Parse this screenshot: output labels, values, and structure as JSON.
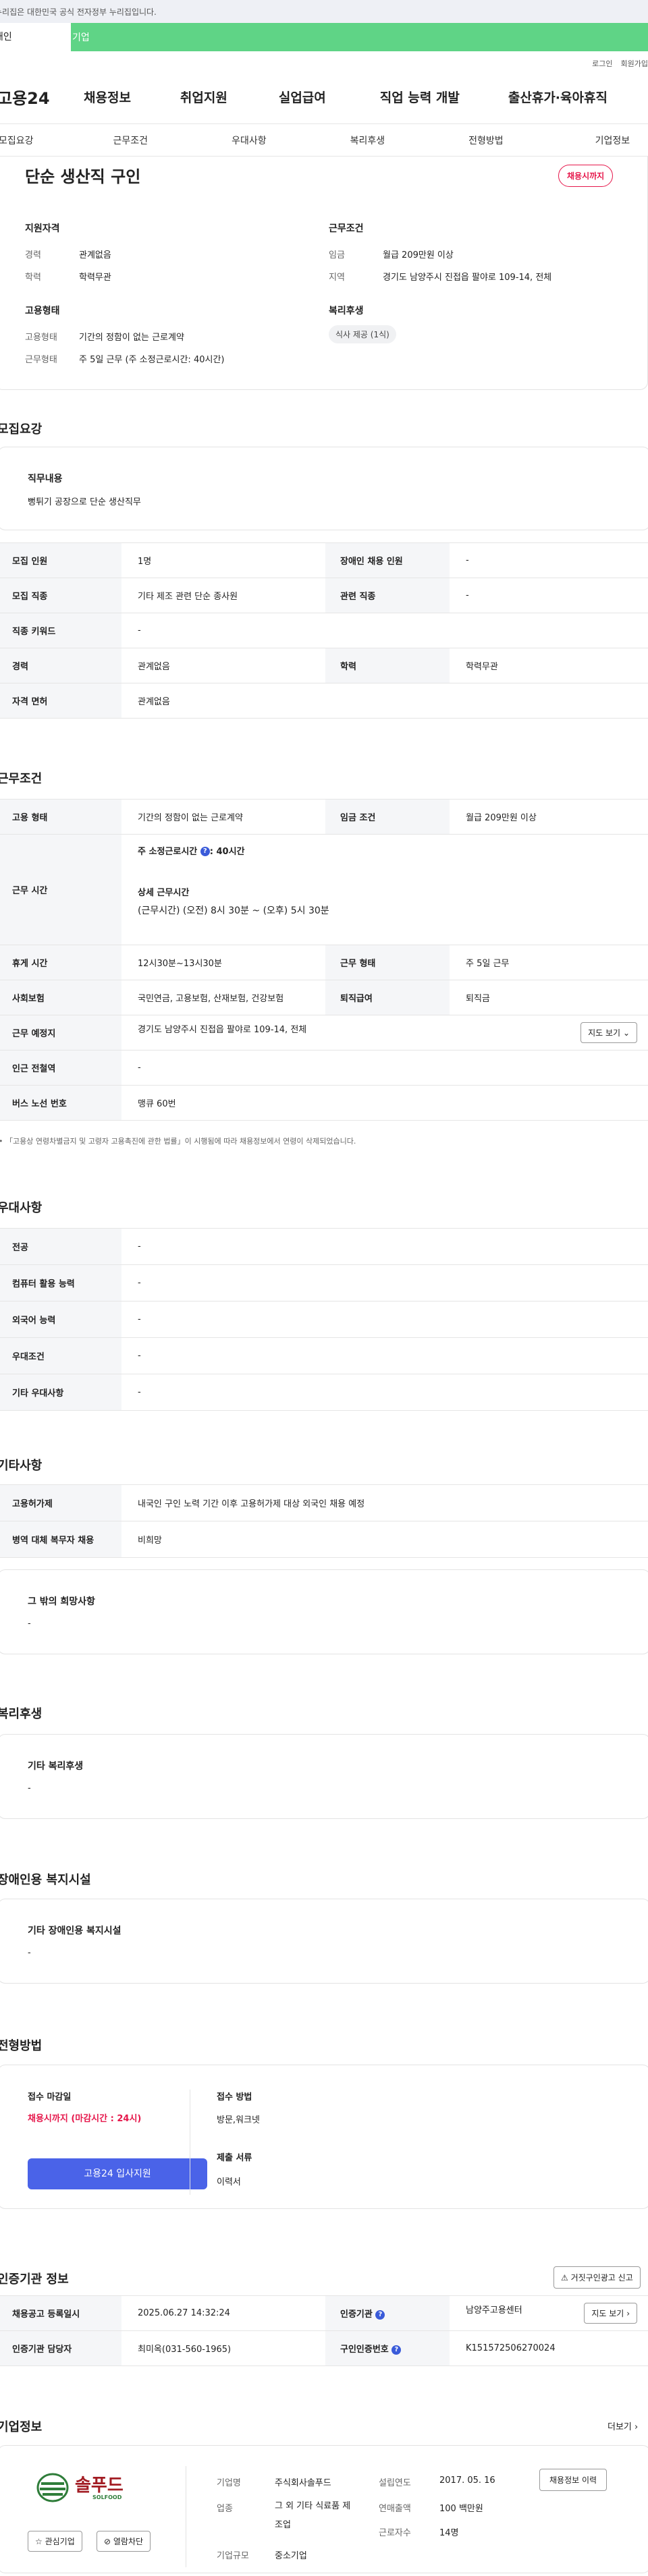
{
  "top_notice": "누리집은 대한민국 공식 전자정부 누리집입니다.",
  "site_tabs": [
    "개인",
    "기업"
  ],
  "util": {
    "login": "로그인",
    "join": "회원가입"
  },
  "gnb": {
    "logo": "고용24",
    "menu": [
      "채용정보",
      "취업지원",
      "실업급여",
      "직업 능력 개발",
      "출산휴가·육아휴직"
    ]
  },
  "tabs": [
    "모집요강",
    "근무조건",
    "우대사항",
    "복리후생",
    "전형방법",
    "기업정보"
  ],
  "summary": {
    "title": "단순 생산직 구인",
    "status": "채용시까지",
    "qual_title": "지원자격",
    "career_label": "경력",
    "career": "관계없음",
    "edu_label": "학력",
    "edu": "학력무관",
    "cond_title": "근무조건",
    "wage_label": "임금",
    "wage": "월급 209만원 이상",
    "loc_label": "지역",
    "loc": "경기도 남양주시 진접읍 팔야로 109-14, 전체",
    "emp_title": "고용형태",
    "emp_type_label": "고용형태",
    "emp_type": "기간의 정함이 없는 근로계약",
    "work_type_label": "근무형태",
    "work_type": "주 5일 근무 (주 소정근로시간: 40시간)",
    "welfare_title": "복리후생",
    "welfare_pill": "식사 제공 (1식)"
  },
  "recruit": {
    "title": "모집요강",
    "duty_label": "직무내용",
    "duty": "뻥튀기 공장으로 단순 생산직무",
    "rows": [
      [
        "모집 인원",
        "1명",
        "장애인 채용 인원",
        "-"
      ],
      [
        "모집 직종",
        "기타 제조 관련 단순 종사원",
        "관련 직종",
        "-"
      ]
    ],
    "kw_label": "직종 키워드",
    "kw": "-",
    "career_label": "경력",
    "career": "관계없음",
    "edu_label": "학력",
    "edu": "학력무관",
    "license_label": "자격 면허",
    "license": "관계없음"
  },
  "work": {
    "title": "근무조건",
    "emp_label": "고용 형태",
    "emp": "기간의 정함이 없는 근로계약",
    "wage_label": "임금 조건",
    "wage": "월급 209만원 이상",
    "time_label": "근무 시간",
    "weekly": "주 소정근로시간",
    "weekly_val": ": 40시간",
    "detail_title": "상세 근무시간",
    "detail": "(근무시간) (오전) 8시 30분 ~ (오후) 5시 30분",
    "break_label": "휴게 시간",
    "break": "12시30분~13시30분",
    "form_label": "근무 형태",
    "form": "주 5일 근무",
    "ins_label": "사회보험",
    "ins": "국민연금, 고용보험, 산재보험, 건강보험",
    "sev_label": "퇴직급여",
    "sev": "퇴직금",
    "place_label": "근무 예정지",
    "place": "경기도 남양주시 진접읍 팔야로 109-14, 전체",
    "map_btn": "지도 보기",
    "station_label": "인근 전철역",
    "station": "-",
    "bus_label": "버스 노선 번호",
    "bus": "맹큐 60번",
    "note": "「고용상 연령차별금지 및 고령자 고용촉진에 관한 법률」이 시행됨에 따라 채용정보에서 연령이 삭제되었습니다."
  },
  "pref": {
    "title": "우대사항",
    "rows": [
      [
        "전공",
        "-"
      ],
      [
        "컴퓨터 활용 능력",
        "-"
      ],
      [
        "외국어 능력",
        "-"
      ],
      [
        "우대조건",
        "-"
      ],
      [
        "기타 우대사항",
        "-"
      ]
    ]
  },
  "etc": {
    "title": "기타사항",
    "rows": [
      [
        "고용허가제",
        "내국인 구인 노력 기간 이후 고용허가제 대상 외국인 채용 예정"
      ],
      [
        "병역 대체 복무자 채용",
        "비희망"
      ]
    ],
    "other_label": "그 밖의 희망사항",
    "other": "-"
  },
  "welfare": {
    "title": "복리후생",
    "label": "기타 복리후생",
    "value": "-"
  },
  "disab": {
    "title": "장애인용 복지시설",
    "label": "기타 장애인용 복지시설",
    "value": "-"
  },
  "screen": {
    "title": "전형방법",
    "deadline_label": "접수 마감일",
    "deadline": "채용시까지 (마감시간 : 24시)",
    "apply_btn": "고용24 입사지원",
    "method_label": "접수 방법",
    "method": "방문,워크넷",
    "docs_label": "제출 서류",
    "docs": "이력서"
  },
  "agency": {
    "title": "인증기관 정보",
    "report_btn": "거짓구인광고 신고",
    "reg_label": "채용공고 등록일시",
    "reg": "2025.06.27 14:32:24",
    "agency_label": "인증기관",
    "agency": "남양주고용센터",
    "map_btn": "지도 보기",
    "mgr_label": "인증기관 담당자",
    "mgr": "최미옥(031-560-1965)",
    "no_label": "구인인증번호",
    "no": "K151572506270024"
  },
  "company": {
    "title": "기업정보",
    "more": "더보기",
    "logo_text": "솔푸드",
    "logo_sub": "SOLFOOD",
    "fav_btn": "관심기업",
    "block_btn": "열람차단",
    "name_label": "기업명",
    "name": "주식회사솔푸드",
    "ind_label": "업종",
    "ind": "그 외 기타 식료품 제조업",
    "size_label": "기업규모",
    "size": "중소기업",
    "year_label": "설립연도",
    "year": "2017. 05. 16",
    "sales_label": "연매출액",
    "sales": "100 백만원",
    "emp_label": "근로자수",
    "emp": "14명",
    "hist_btn": "채용정보 이력"
  },
  "colors": {
    "green": "#5fd486",
    "red": "#e6174b",
    "blue": "#3a5bd9"
  }
}
